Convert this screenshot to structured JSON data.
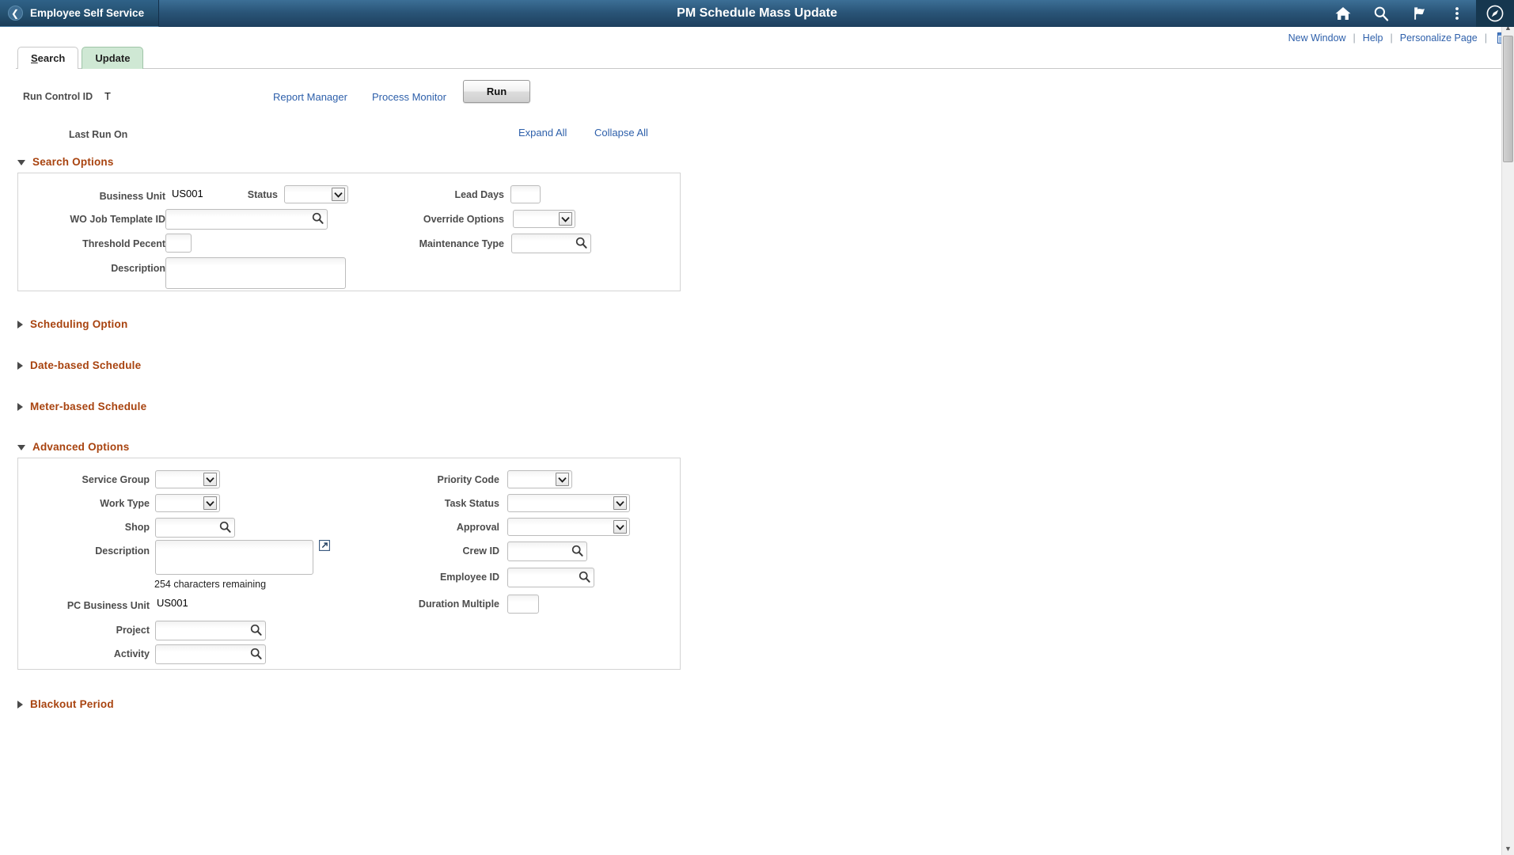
{
  "navbar": {
    "back_label": "Employee Self Service",
    "back_icon": "chevron-left-icon",
    "title": "PM Schedule Mass Update",
    "icons": [
      {
        "name": "home-icon",
        "label": "Home"
      },
      {
        "name": "search-icon",
        "label": "Search"
      },
      {
        "name": "flag-notification-icon",
        "label": "Notifications"
      },
      {
        "name": "kebab-menu-icon",
        "label": "Actions"
      },
      {
        "name": "navbar-compass-icon",
        "label": "NavBar"
      }
    ]
  },
  "subheader": {
    "new_window": "New Window",
    "help": "Help",
    "personalize_page": "Personalize Page",
    "separator": "|",
    "grid_icon": "page-layout-icon"
  },
  "tabs": [
    {
      "label": "Search",
      "accesskey": "S",
      "active": false
    },
    {
      "label": "Update",
      "accesskey": "",
      "active": true
    }
  ],
  "run_control": {
    "label": "Run Control ID",
    "value": "T",
    "report_manager": "Report Manager",
    "process_monitor": "Process Monitor",
    "run_button": "Run"
  },
  "last_run": {
    "label": "Last Run On",
    "value": "",
    "expand_all": "Expand All",
    "collapse_all": "Collapse All"
  },
  "sections": {
    "search_options": {
      "title": "Search Options",
      "expanded": true,
      "fields": {
        "business_unit": {
          "label": "Business Unit",
          "value": "US001",
          "type": "static"
        },
        "status": {
          "label": "Status",
          "value": "",
          "type": "select"
        },
        "lead_days": {
          "label": "Lead Days",
          "value": "",
          "type": "text"
        },
        "wo_job_template_id": {
          "label": "WO Job Template ID",
          "value": "",
          "type": "lookup"
        },
        "override_options": {
          "label": "Override Options",
          "value": "",
          "type": "select"
        },
        "threshold_percent": {
          "label": "Threshold Pecent",
          "value": "",
          "type": "text"
        },
        "maintenance_type": {
          "label": "Maintenance Type",
          "value": "",
          "type": "lookup"
        },
        "description": {
          "label": "Description",
          "value": "",
          "type": "textarea"
        }
      }
    },
    "scheduling_option": {
      "title": "Scheduling Option",
      "expanded": false
    },
    "date_based_schedule": {
      "title": "Date-based Schedule",
      "expanded": false
    },
    "meter_based_schedule": {
      "title": "Meter-based Schedule",
      "expanded": false
    },
    "advanced_options": {
      "title": "Advanced Options",
      "expanded": true,
      "fields": {
        "service_group": {
          "label": "Service Group",
          "value": "",
          "type": "select"
        },
        "priority_code": {
          "label": "Priority Code",
          "value": "",
          "type": "select"
        },
        "work_type": {
          "label": "Work Type",
          "value": "",
          "type": "select"
        },
        "task_status": {
          "label": "Task Status",
          "value": "",
          "type": "select"
        },
        "shop": {
          "label": "Shop",
          "value": "",
          "type": "lookup"
        },
        "approval": {
          "label": "Approval",
          "value": "",
          "type": "select"
        },
        "description": {
          "label": "Description",
          "value": "",
          "type": "textarea",
          "hint": "254 characters remaining",
          "expand_icon": "expand-textarea-icon"
        },
        "crew_id": {
          "label": "Crew ID",
          "value": "",
          "type": "lookup"
        },
        "employee_id": {
          "label": "Employee ID",
          "value": "",
          "type": "lookup"
        },
        "pc_business_unit": {
          "label": "PC Business Unit",
          "value": "US001",
          "type": "static"
        },
        "duration_multiple": {
          "label": "Duration Multiple",
          "value": "",
          "type": "text"
        },
        "project": {
          "label": "Project",
          "value": "",
          "type": "lookup"
        },
        "activity": {
          "label": "Activity",
          "value": "",
          "type": "lookup"
        }
      }
    },
    "blackout_period": {
      "title": "Blackout Period",
      "expanded": false
    }
  },
  "colors": {
    "navbar_top": "#3c6f96",
    "navbar_bottom": "#1d3f5e",
    "section_title": "#a8430f",
    "link": "#2d5faa",
    "active_tab_bg": "#cfe8d4",
    "label": "#4c4c4c"
  }
}
